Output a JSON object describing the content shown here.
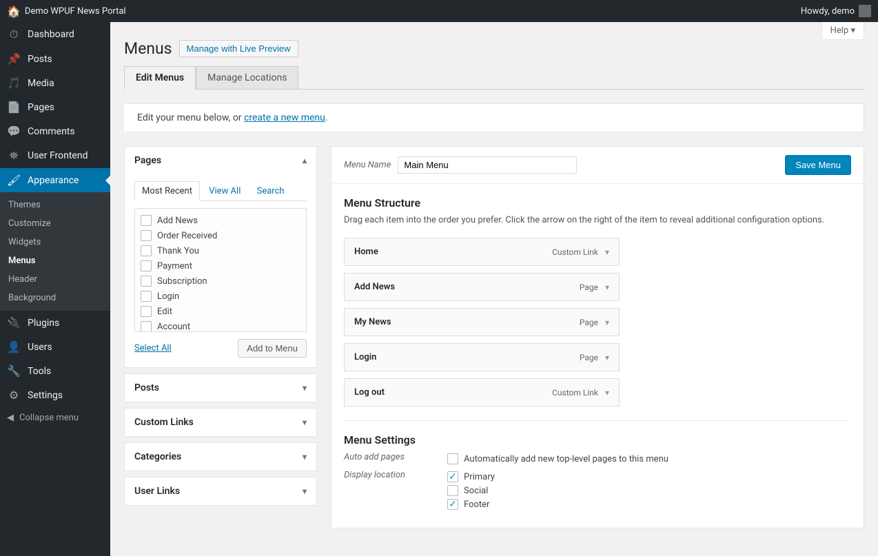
{
  "topbar": {
    "site_name": "Demo WPUF News Portal",
    "howdy": "Howdy, demo"
  },
  "sidebar": {
    "items": [
      {
        "label": "Dashboard",
        "glyph": "⏱"
      },
      {
        "label": "Posts",
        "glyph": "📌"
      },
      {
        "label": "Media",
        "glyph": "🎵"
      },
      {
        "label": "Pages",
        "glyph": "📄"
      },
      {
        "label": "Comments",
        "glyph": "💬"
      },
      {
        "label": "User Frontend",
        "glyph": "⛯"
      },
      {
        "label": "Appearance",
        "glyph": "🖌",
        "active": true
      },
      {
        "label": "Plugins",
        "glyph": "🔌"
      },
      {
        "label": "Users",
        "glyph": "👤"
      },
      {
        "label": "Tools",
        "glyph": "🔧"
      },
      {
        "label": "Settings",
        "glyph": "⚙"
      }
    ],
    "appearance_sub": [
      "Themes",
      "Customize",
      "Widgets",
      "Menus",
      "Header",
      "Background"
    ],
    "collapse": "Collapse menu"
  },
  "help_tab": "Help",
  "page": {
    "title": "Menus",
    "live_preview_btn": "Manage with Live Preview"
  },
  "tabs": [
    "Edit Menus",
    "Manage Locations"
  ],
  "notice": {
    "prefix": "Edit your menu below, or ",
    "link": "create a new menu",
    "suffix": "."
  },
  "left": {
    "pages_title": "Pages",
    "sub_tabs": [
      "Most Recent",
      "View All",
      "Search"
    ],
    "page_items": [
      "Add News",
      "Order Received",
      "Thank You",
      "Payment",
      "Subscription",
      "Login",
      "Edit",
      "Account"
    ],
    "select_all": "Select All",
    "add_to_menu": "Add to Menu",
    "accordion": [
      "Posts",
      "Custom Links",
      "Categories",
      "User Links"
    ]
  },
  "right": {
    "menu_name_label": "Menu Name",
    "menu_name_value": "Main Menu",
    "save_btn": "Save Menu",
    "structure_title": "Menu Structure",
    "structure_desc": "Drag each item into the order you prefer. Click the arrow on the right of the item to reveal additional configuration options.",
    "menu_items": [
      {
        "label": "Home",
        "type": "Custom Link"
      },
      {
        "label": "Add News",
        "type": "Page"
      },
      {
        "label": "My News",
        "type": "Page"
      },
      {
        "label": "Login",
        "type": "Page"
      },
      {
        "label": "Log out",
        "type": "Custom Link"
      }
    ],
    "settings_title": "Menu Settings",
    "auto_add_label": "Auto add pages",
    "auto_add_option": "Automatically add new top-level pages to this menu",
    "display_loc_label": "Display location",
    "locations": [
      {
        "label": "Primary",
        "checked": true
      },
      {
        "label": "Social",
        "checked": false
      },
      {
        "label": "Footer",
        "checked": true
      }
    ]
  }
}
